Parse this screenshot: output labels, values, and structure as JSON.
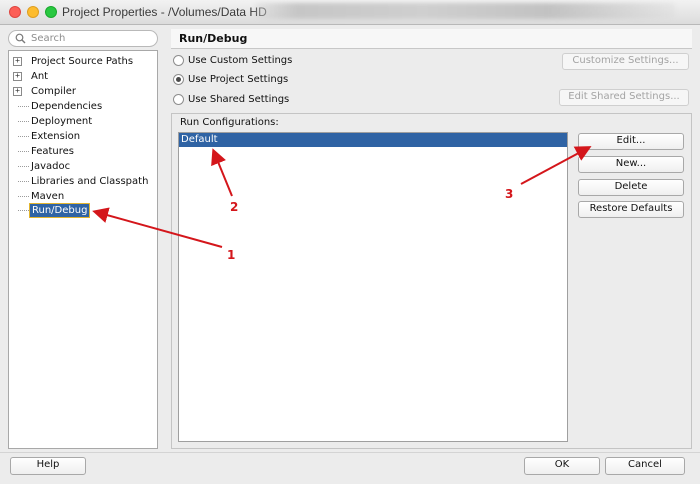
{
  "window": {
    "title": "Project Properties - /Volumes/Data HD"
  },
  "search": {
    "placeholder": "Search"
  },
  "tree": {
    "items": [
      {
        "label": "Project Source Paths",
        "expandable": true
      },
      {
        "label": "Ant",
        "expandable": true
      },
      {
        "label": "Compiler",
        "expandable": true
      },
      {
        "label": "Dependencies",
        "expandable": false
      },
      {
        "label": "Deployment",
        "expandable": false
      },
      {
        "label": "Extension",
        "expandable": false
      },
      {
        "label": "Features",
        "expandable": false
      },
      {
        "label": "Javadoc",
        "expandable": false
      },
      {
        "label": "Libraries and Classpath",
        "expandable": false
      },
      {
        "label": "Maven",
        "expandable": false
      },
      {
        "label": "Run/Debug",
        "expandable": false,
        "selected": true
      }
    ],
    "expander_symbol": "+"
  },
  "page": {
    "title": "Run/Debug",
    "radios": [
      {
        "label": "Use Custom Settings",
        "checked": false
      },
      {
        "label": "Use Project Settings",
        "checked": true
      },
      {
        "label": "Use Shared Settings",
        "checked": false
      }
    ],
    "customize_button": "Customize Settings...",
    "edit_shared_button": "Edit Shared Settings...",
    "run_configurations_label": "Run Configurations:",
    "run_configurations": [
      "Default"
    ],
    "buttons": {
      "edit": "Edit...",
      "new": "New...",
      "delete": "Delete",
      "restore": "Restore Defaults"
    }
  },
  "footer": {
    "help": "Help",
    "ok": "OK",
    "cancel": "Cancel"
  },
  "annotations": {
    "labels": [
      "1",
      "2",
      "3"
    ],
    "arrow_color": "#d4161b"
  },
  "colors": {
    "selection": "#2f63a4",
    "selection_border": "#e3b52f"
  }
}
